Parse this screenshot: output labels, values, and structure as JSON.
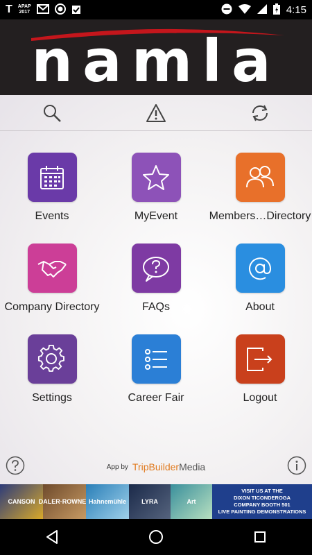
{
  "status_bar": {
    "carrier_icon": "T",
    "apap_line1": "APAP",
    "apap_line2": "2017",
    "time": "4:15",
    "icons": [
      "gmail-icon",
      "record-icon",
      "clipboard-check-icon",
      "do-not-disturb-icon",
      "wifi-icon",
      "signal-icon",
      "battery-charging-icon"
    ]
  },
  "header": {
    "logo_text": "namla",
    "brand_color": "#c4161c"
  },
  "toolbar": {
    "icons": [
      "search-icon",
      "alert-icon",
      "sync-icon"
    ]
  },
  "tiles": [
    {
      "label": "Events",
      "color": "#6a3aa8",
      "icon": "calendar-icon"
    },
    {
      "label": "MyEvent",
      "color": "#8d52b8",
      "icon": "star-icon"
    },
    {
      "label": "Members…Directory",
      "color": "#e8702a",
      "icon": "people-icon"
    },
    {
      "label": "Company Directory",
      "color": "#cc3e97",
      "icon": "handshake-icon"
    },
    {
      "label": "FAQs",
      "color": "#7e3aa3",
      "icon": "question-bubble-icon"
    },
    {
      "label": "About",
      "color": "#2a8ee0",
      "icon": "at-icon"
    },
    {
      "label": "Settings",
      "color": "#6a3f99",
      "icon": "gear-icon"
    },
    {
      "label": "Career Fair",
      "color": "#2b7fd6",
      "icon": "list-icon"
    },
    {
      "label": "Logout",
      "color": "#c9401c",
      "icon": "logout-icon"
    }
  ],
  "footer": {
    "app_by": "App by",
    "brand_a": "TripBuilder",
    "brand_b": "Media"
  },
  "ad": {
    "segments": [
      "CANSON",
      "DALER·ROWNEY",
      "Hahnemühle",
      "LYRA",
      "Art"
    ],
    "line1": "VISIT US AT THE",
    "line2": "DIXON TICONDEROGA",
    "line3": "COMPANY BOOTH 501",
    "line4": "LIVE PAINTING DEMONSTRATIONS"
  },
  "navbar": {
    "icons": [
      "back-icon",
      "home-icon",
      "recents-icon"
    ]
  }
}
